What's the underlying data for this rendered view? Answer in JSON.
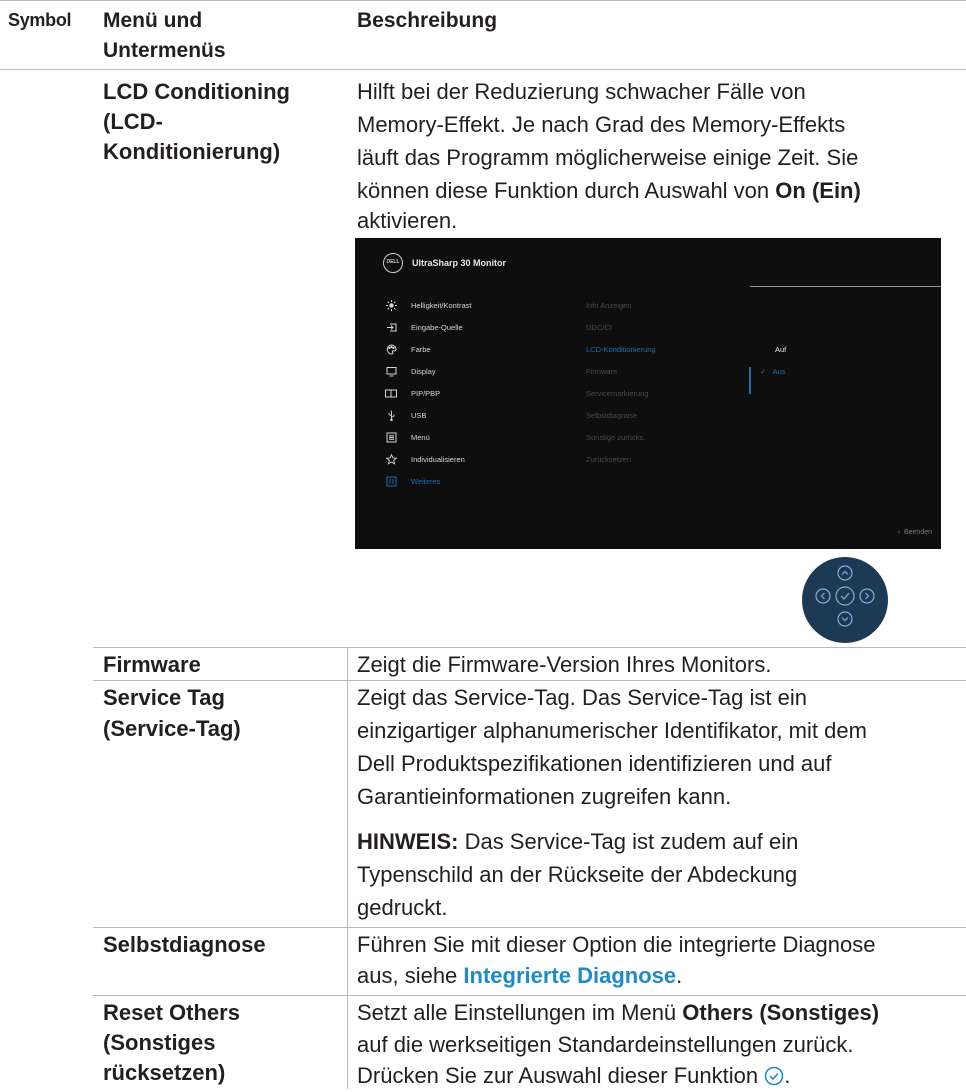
{
  "header": {
    "symbol": "Symbol",
    "menu": "Menü und Untermenüs",
    "description": "Beschreibung"
  },
  "rows": {
    "lcd": {
      "name": "LCD Conditioning (LCD-Konditionierung)",
      "desc_lines": [
        "Hilft bei der Reduzierung schwacher Fälle von",
        "Memory-Effekt. Je nach Grad des Memory-Effekts",
        "läuft das Programm möglicherweise einige Zeit. Sie"
      ],
      "desc_line4_pre": "können diese Funktion durch Auswahl von ",
      "desc_line4_bold": "On (Ein)",
      "desc_line5": "aktivieren."
    },
    "firmware": {
      "name": "Firmware",
      "desc": "Zeigt die Firmware-Version Ihres Monitors."
    },
    "service": {
      "name_line1": "Service Tag",
      "name_line2": "(Service-Tag)",
      "desc_lines": [
        "Zeigt das Service-Tag. Das Service-Tag ist ein",
        "einzigartiger alphanumerischer Identifikator, mit dem",
        "Dell Produktspezifikationen identifizieren und auf",
        "Garantieinformationen zugreifen kann."
      ],
      "note_label": "HINWEIS:",
      "note_line1": " Das Service-Tag ist zudem auf ein",
      "note_line2": "Typenschild an der Rückseite der Abdeckung",
      "note_line3": "gedruckt."
    },
    "selftest": {
      "name": "Selbstdiagnose",
      "desc_line1": "Führen Sie mit dieser Option die integrierte Diagnose",
      "desc_line2_pre": "aus, siehe ",
      "desc_line2_link": "Integrierte Diagnose",
      "desc_line2_post": "."
    },
    "reset": {
      "name_line1": "Reset Others",
      "name_line2": "(Sonstiges",
      "name_line3": "rücksetzen)",
      "desc_line1_pre": "Setzt alle Einstellungen im Menü ",
      "desc_line1_bold": "Others (Sonstiges)",
      "desc_line2": "auf die werkseitigen Standardeinstellungen zurück.",
      "desc_line3": "Drücken Sie zur Auswahl dieser Funktion"
    }
  },
  "osd": {
    "logo": "DELL",
    "title": "UltraSharp 30 Monitor",
    "menu": [
      {
        "label": "Helligkeit/Kontrast",
        "icon": "brightness-icon"
      },
      {
        "label": "Eingabe-Quelle",
        "icon": "input-source-icon"
      },
      {
        "label": "Farbe",
        "icon": "color-palette-icon"
      },
      {
        "label": "Display",
        "icon": "display-icon"
      },
      {
        "label": "PIP/PBP",
        "icon": "pip-icon"
      },
      {
        "label": "USB",
        "icon": "usb-icon"
      },
      {
        "label": "Menü",
        "icon": "menu-icon"
      },
      {
        "label": "Individualisieren",
        "icon": "star-icon"
      },
      {
        "label": "Weiteres",
        "icon": "others-icon"
      }
    ],
    "sub": [
      "Info Anzeigen",
      "DDC/CI",
      "LCD-Konditionierung",
      "Firmware",
      "Servicemarkierung",
      "Selbstdiagnose",
      "Sonstige zurücks.",
      "Zurücksetzen"
    ],
    "options": {
      "on": "Auf",
      "off": "Aus"
    },
    "exit": "Beenden",
    "colors": {
      "active": "#1b6fb3",
      "background": "#0e0e0e"
    }
  },
  "colors": {
    "link": "#1f8ac9",
    "rule": "#b9b9b9"
  }
}
